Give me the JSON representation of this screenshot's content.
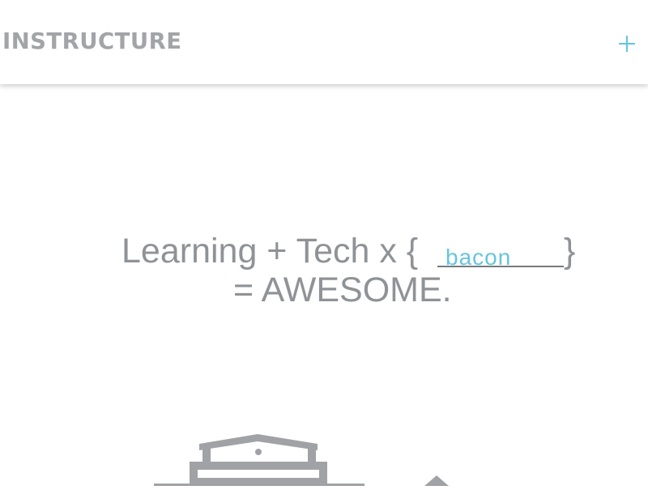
{
  "header": {
    "logo_text": "INSTRUCTURE",
    "plus_icon": "plus-icon",
    "accent_color": "#5fc6e0"
  },
  "hero": {
    "line1_text": "Learning + Tech x {",
    "blank_word": "bacon",
    "line1_close": "}",
    "line2_text": "= AWESOME."
  },
  "illustration": {
    "icon": "school-building-icon"
  }
}
